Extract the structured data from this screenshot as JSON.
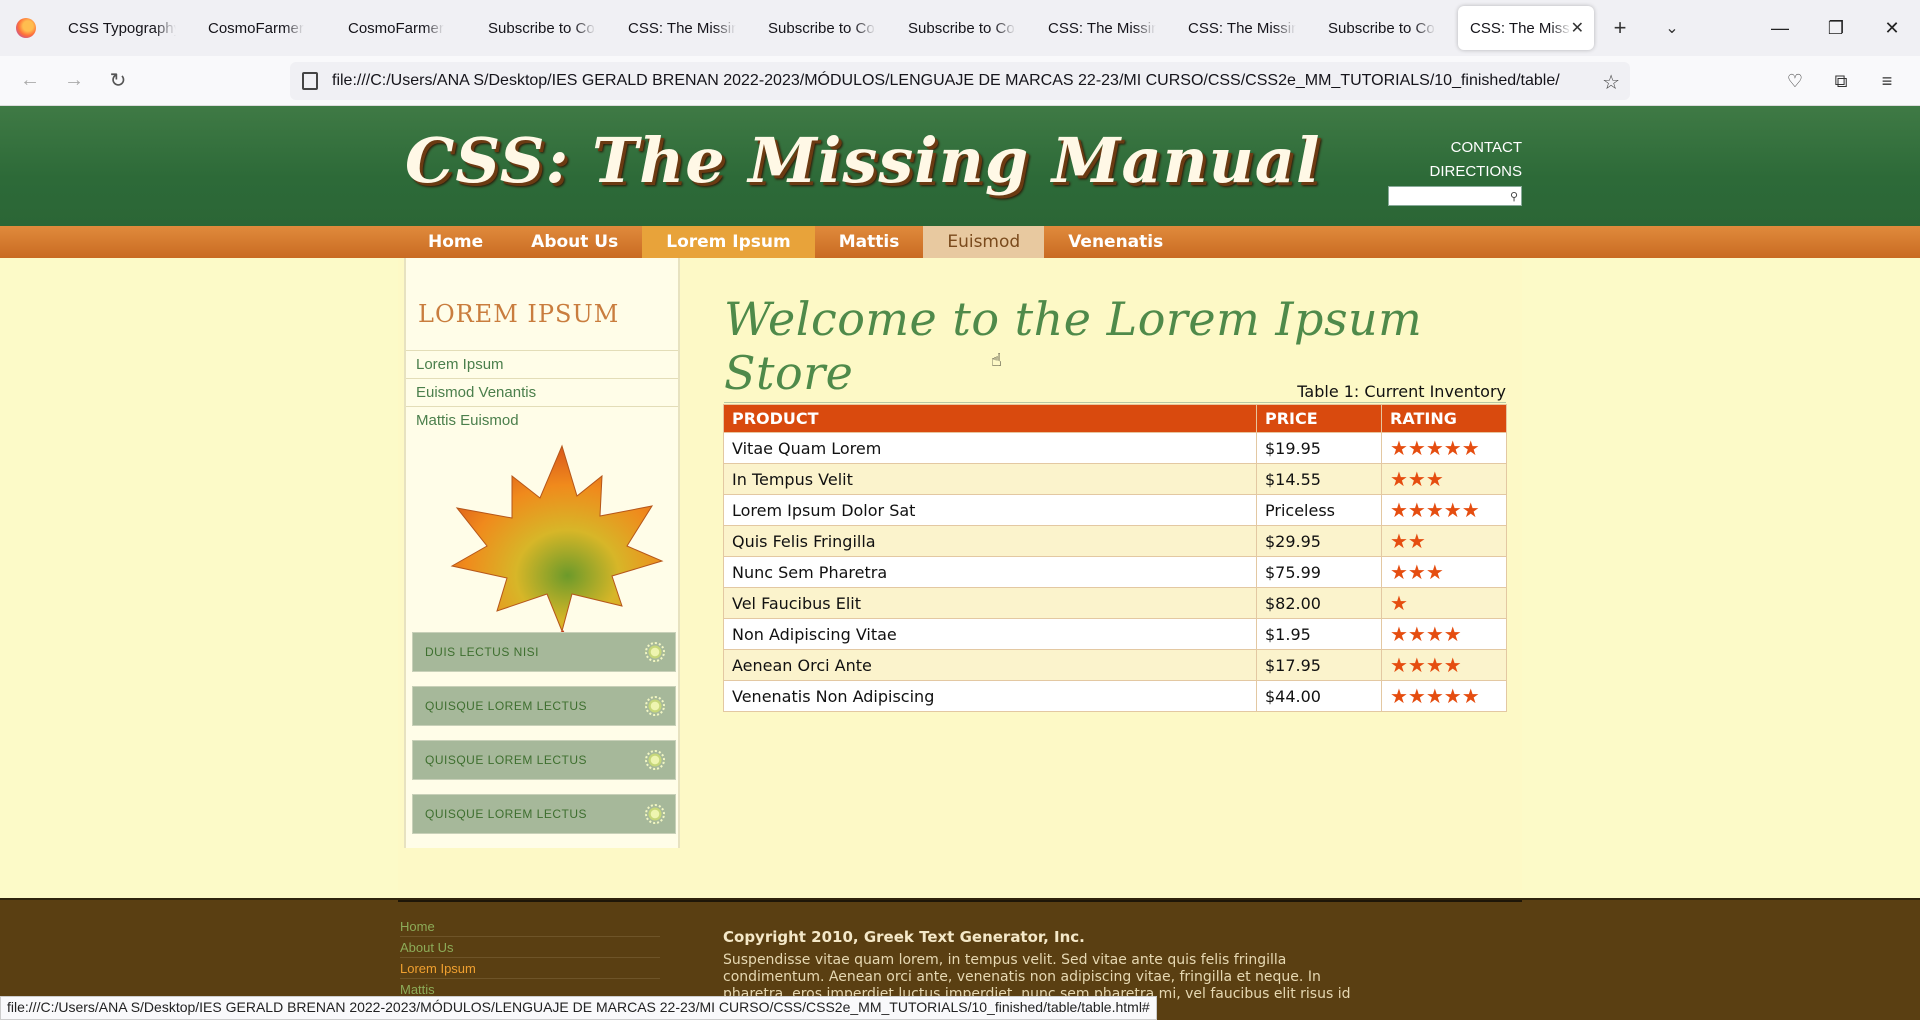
{
  "browser": {
    "tabs": [
      {
        "label": "CSS Typography"
      },
      {
        "label": "CosmoFarmer"
      },
      {
        "label": "CosmoFarmer"
      },
      {
        "label": "Subscribe to Cosm"
      },
      {
        "label": "CSS: The Missing"
      },
      {
        "label": "Subscribe to Cosm"
      },
      {
        "label": "Subscribe to Cosm"
      },
      {
        "label": "CSS: The Missing"
      },
      {
        "label": "CSS: The Missing"
      },
      {
        "label": "Subscribe to Cosm"
      }
    ],
    "active_tab": "CSS: The Missing",
    "url": "file:///C:/Users/ANA S/Desktop/IES GERALD BRENAN 2022-2023/MÓDULOS/LENGUAJE DE MARCAS 22-23/MI CURSO/CSS/CSS2e_MM_TUTORIALS/10_finished/table/",
    "status_url": "file:///C:/Users/ANA S/Desktop/IES GERALD BRENAN 2022-2023/MÓDULOS/LENGUAJE DE MARCAS 22-23/MI CURSO/CSS/CSS2e_MM_TUTORIALS/10_finished/table/table.html#"
  },
  "header": {
    "logo": "CSS: The Missing Manual",
    "links": [
      "CONTACT",
      "DIRECTIONS"
    ]
  },
  "mainnav": [
    {
      "label": "Home",
      "state": "normal"
    },
    {
      "label": "About Us",
      "state": "normal"
    },
    {
      "label": "Lorem Ipsum",
      "state": "selected"
    },
    {
      "label": "Mattis",
      "state": "normal"
    },
    {
      "label": "Euismod",
      "state": "hover"
    },
    {
      "label": "Venenatis",
      "state": "normal"
    }
  ],
  "sidebar": {
    "title": "LOREM IPSUM",
    "links": [
      "Lorem Ipsum",
      "Euismod Venantis",
      "Mattis Euismod"
    ],
    "buttons": [
      "DUIS LECTUS NISI",
      "QUISQUE LOREM LECTUS",
      "QUISQUE LOREM LECTUS",
      "QUISQUE LOREM LECTUS"
    ]
  },
  "main": {
    "title": "Welcome to the Lorem Ipsum Store",
    "table_caption": "Table 1: Current Inventory",
    "columns": [
      "PRODUCT",
      "PRICE",
      "RATING"
    ],
    "rows": [
      {
        "product": "Vitae Quam Lorem",
        "price": "$19.95",
        "rating": 5
      },
      {
        "product": "In Tempus Velit",
        "price": "$14.55",
        "rating": 3
      },
      {
        "product": "Lorem Ipsum Dolor Sat",
        "price": "Priceless",
        "rating": 5
      },
      {
        "product": "Quis Felis Fringilla",
        "price": "$29.95",
        "rating": 2
      },
      {
        "product": "Nunc Sem Pharetra",
        "price": "$75.99",
        "rating": 3
      },
      {
        "product": "Vel Faucibus Elit",
        "price": "$82.00",
        "rating": 1
      },
      {
        "product": "Non Adipiscing Vitae",
        "price": "$1.95",
        "rating": 4
      },
      {
        "product": "Aenean Orci Ante",
        "price": "$17.95",
        "rating": 4
      },
      {
        "product": "Venenatis Non Adipiscing",
        "price": "$44.00",
        "rating": 5
      }
    ]
  },
  "footer": {
    "links": [
      {
        "label": "Home",
        "current": false
      },
      {
        "label": "About Us",
        "current": false
      },
      {
        "label": "Lorem Ipsum",
        "current": true
      },
      {
        "label": "Mattis",
        "current": false
      }
    ],
    "copyright": "Copyright 2010, Greek Text Generator, Inc.",
    "text": "Suspendisse vitae quam lorem, in tempus velit. Sed vitae ante quis felis fringilla condimentum. Aenean orci ante, venenatis non adipiscing vitae, fringilla et neque. In pharetra, eros imperdiet luctus imperdiet, nunc sem pharetra mi, vel faucibus elit risus id tortor."
  },
  "colors": {
    "banner": "#2d6a38",
    "nav": "#d07a2e",
    "table_header": "#d94a0e",
    "star": "#e54d10",
    "footer": "#5a3f12"
  }
}
